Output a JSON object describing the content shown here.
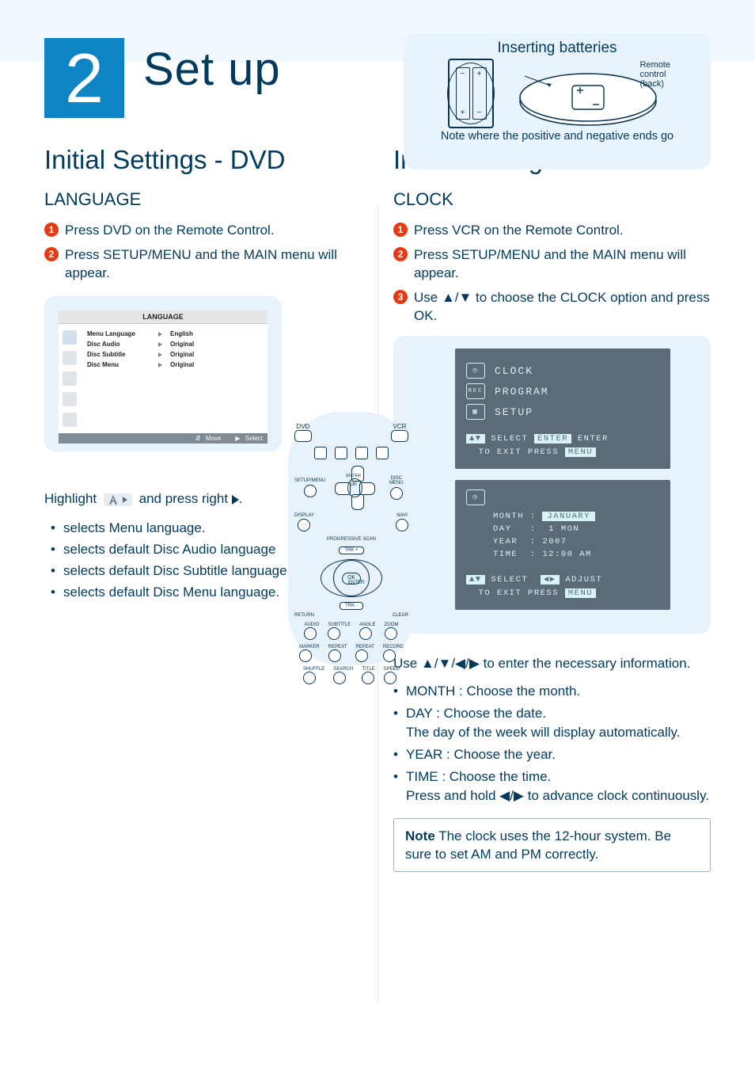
{
  "header": {
    "step_number": "2",
    "title": "Set up"
  },
  "battery": {
    "heading": "Inserting batteries",
    "label_line1": "Remote",
    "label_line2": "control",
    "label_line3": "(back)",
    "note": "Note where the positive and negative ends go"
  },
  "dvd": {
    "h2": "Initial Settings - DVD",
    "h3": "LANGUAGE",
    "steps": [
      "Press DVD on the Remote Control.",
      "Press SETUP/MENU and the MAIN menu will appear."
    ],
    "osd": {
      "title": "LANGUAGE",
      "rows": [
        {
          "label": "Menu Language",
          "value": "English"
        },
        {
          "label": "Disc Audio",
          "value": "Original"
        },
        {
          "label": "Disc Subtitle",
          "value": "Original"
        },
        {
          "label": "Disc Menu",
          "value": "Original"
        }
      ],
      "foot_move": "Move",
      "foot_select": "Select"
    },
    "highlight_before": "Highlight ",
    "highlight_after": " and press right ",
    "highlight_period": ".",
    "bullets": [
      "selects Menu language.",
      "selects default Disc Audio language",
      "selects default Disc Subtitle language.",
      "selects default Disc Menu language."
    ]
  },
  "vcr": {
    "h2": "Initial Settings - VCR",
    "h3": "CLOCK",
    "steps": [
      "Press VCR on the Remote Control.",
      "Press SETUP/MENU and the MAIN menu will appear.",
      "Use ▲/▼ to choose the CLOCK option and press OK."
    ],
    "osd1": {
      "item1": "CLOCK",
      "item2": "PROGRAM",
      "item3": "SETUP",
      "foot_l1a": "SELECT",
      "foot_l1b": "ENTER",
      "foot_l1c": "ENTER",
      "foot_l2": "TO EXIT PRESS",
      "foot_l2b": "MENU"
    },
    "osd2": {
      "month_label": "MONTH",
      "month_value": "JANUARY",
      "day_label": "DAY",
      "day_value": "1 MON",
      "year_label": "YEAR",
      "year_value": "2007",
      "time_label": "TIME",
      "time_value": "12:00 AM",
      "foot_l1a": "SELECT",
      "foot_l1b": "ADJUST",
      "foot_l2": "TO EXIT PRESS",
      "foot_l2b": "MENU"
    },
    "use_text": "Use ▲/▼/◀/▶ to enter the necessary information.",
    "sub_bullets": [
      "MONTH : Choose the month.",
      "DAY : Choose the date.\nThe day of the week will display automatically.",
      "YEAR : Choose the year.",
      "TIME : Choose the time.\nPress and hold ◀/▶ to advance clock continuously."
    ],
    "note_bold": "Note",
    "note_text": " The clock uses the 12-hour system. Be sure to set AM and PM correctly."
  },
  "remote": {
    "dvd": "DVD",
    "vcr": "VCR",
    "setupmenu": "SETUP/MENU",
    "discmenu": "DISC MENU",
    "enter": "ENTER",
    "ok": "OK",
    "trkplus": "TRK +",
    "trkminus": "TRK -",
    "display": "DISPLAY",
    "navi": "NAVI",
    "return": "RETURN",
    "clear": "CLEAR",
    "r1a": "AUDIO",
    "r1b": "SUBTITLE",
    "r1c": "ANGLE",
    "r1d": "ZOOM",
    "r2a": "MARKER",
    "r2b": "REPEAT",
    "r2c": "REPEAT",
    "r2d": "RECORD",
    "r3a": "SHUFFLE",
    "r3b": "SEARCH",
    "r3c": "TITLE",
    "r3d": "SPEED",
    "progressive": "PROGRESSIVE SCAN"
  }
}
